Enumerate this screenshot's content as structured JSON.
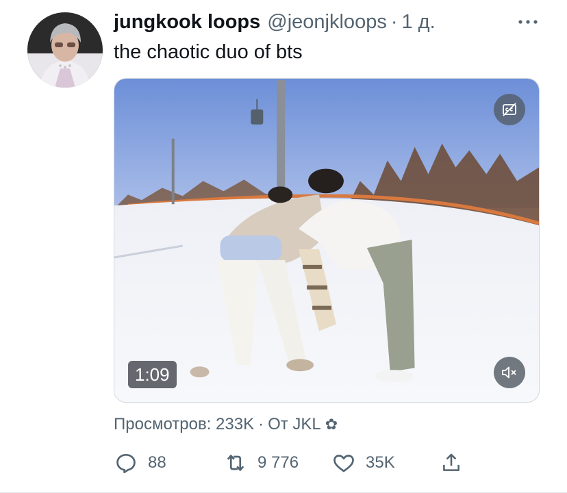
{
  "tweet": {
    "display_name": "jungkook loops",
    "handle": "@jeonjkloops",
    "separator": "·",
    "time": "1 д.",
    "text": "the chaotic duo of bts"
  },
  "media": {
    "duration": "1:09",
    "cc_icon": "closed-captions-off-icon",
    "mute_icon": "muted-speaker-icon"
  },
  "meta": {
    "views_label": "Просмотров: 233K",
    "separator": "·",
    "source": "От JKL",
    "flower": "✿"
  },
  "actions": {
    "replies": "88",
    "retweets": "9 776",
    "likes": "35K"
  },
  "colors": {
    "text_primary": "#0f1419",
    "text_secondary": "#536471"
  }
}
